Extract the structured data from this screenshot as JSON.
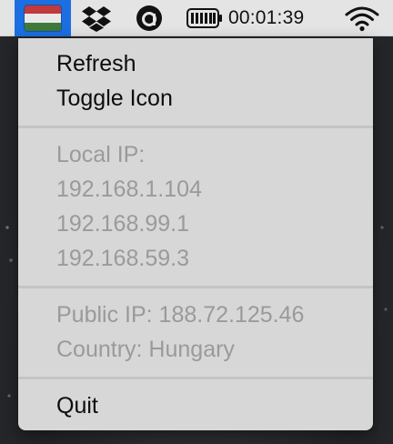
{
  "menubar": {
    "flag_item": {
      "icon": "hungary-flag-icon",
      "flag_colors": [
        "#c0393b",
        "#e8e8e8",
        "#3f7a3a"
      ]
    },
    "dropbox": {
      "icon": "dropbox-icon"
    },
    "aiv": {
      "icon": "circle-a-icon"
    },
    "battery": {
      "icon": "battery-icon"
    },
    "clock": {
      "time": "00:01:39"
    },
    "wifi": {
      "icon": "wifi-icon"
    },
    "selected_color": "#1c6fe0"
  },
  "menu": {
    "refresh_label": "Refresh",
    "toggle_icon_label": "Toggle Icon",
    "local_ip_label": "Local IP:",
    "local_ips": [
      "192.168.1.104",
      "192.168.99.1",
      "192.168.59.3"
    ],
    "public_ip_label": "Public IP: 188.72.125.46",
    "country_label": "Country: Hungary",
    "quit_label": "Quit"
  }
}
